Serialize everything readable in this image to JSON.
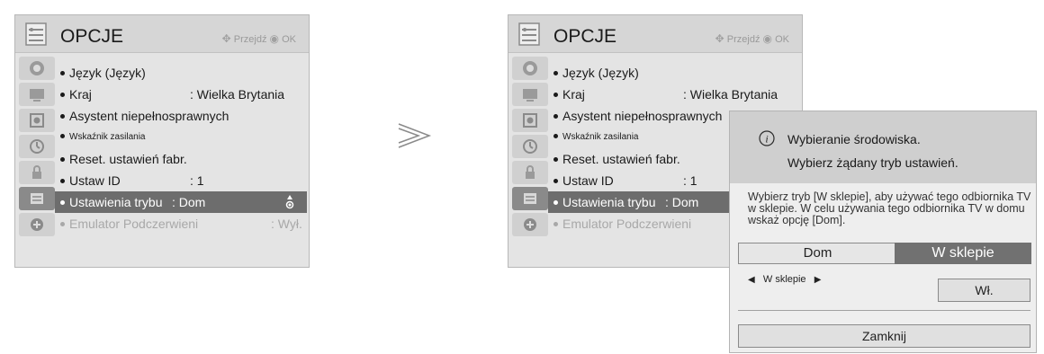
{
  "left_menu": {
    "title": "OPCJE",
    "hint": "Przejdź",
    "hint_ok": "OK",
    "items": [
      {
        "label": "Język (Język)",
        "value": ""
      },
      {
        "label": "Kraj",
        "value": ": Wielka Brytania"
      },
      {
        "label": "Asystent niepełnosprawnych",
        "value": ""
      },
      {
        "label": "Wskaźnik zasilania",
        "value": ""
      },
      {
        "label": "Reset. ustawień fabr.",
        "value": ""
      },
      {
        "label": "Ustaw ID",
        "value": ": 1"
      },
      {
        "label": "Ustawienia trybu",
        "value": ": Dom"
      },
      {
        "label": "Emulator Podczerwieni",
        "value": ": Wył."
      }
    ]
  },
  "right_menu": {
    "title": "OPCJE",
    "hint": "Przejdź",
    "hint_ok": "OK",
    "items": [
      {
        "label": "Język (Język)",
        "value": ""
      },
      {
        "label": "Kraj",
        "value": ": Wielka Brytania"
      },
      {
        "label": "Asystent niepełnosprawnych",
        "value": ""
      },
      {
        "label": "Wskaźnik zasilania",
        "value": ""
      },
      {
        "label": "Reset. ustawień fabr.",
        "value": ""
      },
      {
        "label": "Ustaw ID",
        "value": ": 1"
      },
      {
        "label": "Ustawienia trybu",
        "value": ": Dom"
      },
      {
        "label": "Emulator Podczerwieni",
        "value": ""
      }
    ]
  },
  "popup": {
    "info_line1": "Wybieranie środowiska.",
    "info_line2": "Wybierz żądany tryb ustawień.",
    "description": "Wybierz tryb [W sklepie], aby używać tego odbiornika TV w sklepie. W celu używania tego odbiornika TV w domu wskaż opcję [Dom].",
    "option_home": "Dom",
    "option_store": "W sklepie",
    "selector_value": "W sklepie",
    "toggle_label": "Wł.",
    "close_label": "Zamknij"
  },
  "colors": {
    "menu_bg": "#e4e4e4",
    "selected_bg": "#6d6d6d",
    "disabled_text": "#a8a8a8",
    "popup_bg": "#eeeeee"
  },
  "icons": [
    "options-icon",
    "picture-icon",
    "screen-icon",
    "audio-icon",
    "clock-icon",
    "lock-icon",
    "options-active-icon",
    "usb-icon",
    "move-icon",
    "ok-icon",
    "updown-icon",
    "info-icon",
    "next-arrow-icon"
  ]
}
